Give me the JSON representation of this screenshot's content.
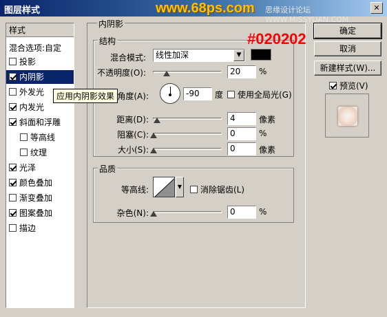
{
  "window": {
    "title": "图层样式",
    "close": "✕"
  },
  "watermark": {
    "site": "www.68ps.com",
    "forum": "思缘设计论坛 WWW.MISSYUAN.COM"
  },
  "annotation": "#020202",
  "left_panel": {
    "header": "样式",
    "blend_options": "混合选项:自定",
    "items": [
      {
        "label": "投影",
        "checked": false
      },
      {
        "label": "内阴影",
        "checked": true,
        "selected": true
      },
      {
        "label": "外发光",
        "checked": false
      },
      {
        "label": "内发光",
        "checked": true
      },
      {
        "label": "斜面和浮雕",
        "checked": true
      },
      {
        "label": "等高线",
        "checked": false,
        "indent": true
      },
      {
        "label": "纹理",
        "checked": false,
        "indent": true
      },
      {
        "label": "光泽",
        "checked": true
      },
      {
        "label": "颜色叠加",
        "checked": true
      },
      {
        "label": "渐变叠加",
        "checked": false
      },
      {
        "label": "图案叠加",
        "checked": true
      },
      {
        "label": "描边",
        "checked": false
      }
    ],
    "tooltip": "应用内阴影效果"
  },
  "inner_shadow": {
    "section_title": "内阴影",
    "structure": {
      "title": "结构",
      "blend_mode_label": "混合模式:",
      "blend_mode_value": "线性加深",
      "color": "#020202",
      "opacity_label": "不透明度(O):",
      "opacity_value": "20",
      "opacity_unit": "%",
      "angle_label": "角度(A):",
      "angle_value": "-90",
      "angle_unit": "度",
      "global_light_label": "使用全局光(G)",
      "distance_label": "距离(D):",
      "distance_value": "4",
      "distance_unit": "像素",
      "choke_label": "阻塞(C):",
      "choke_value": "0",
      "choke_unit": "%",
      "size_label": "大小(S):",
      "size_value": "0",
      "size_unit": "像素"
    },
    "quality": {
      "title": "品质",
      "contour_label": "等高线:",
      "antialias_label": "消除锯齿(L)",
      "noise_label": "杂色(N):",
      "noise_value": "0",
      "noise_unit": "%"
    }
  },
  "buttons": {
    "ok": "确定",
    "cancel": "取消",
    "new_style": "新建样式(W)...",
    "preview_label": "预览(V)"
  }
}
